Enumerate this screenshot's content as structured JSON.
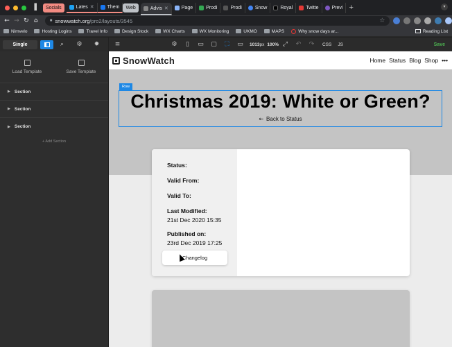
{
  "browser": {
    "tabs": {
      "group_socials": "Socials",
      "group_web": "Web",
      "items": [
        {
          "label": "Lates",
          "color": "#1da1f2"
        },
        {
          "label": "Them",
          "color": "#1877f2"
        },
        {
          "label": "Advis",
          "color": "#888888"
        },
        {
          "label": "Page",
          "color": "#8ab4f8"
        },
        {
          "label": "Prodi",
          "color": "#34a853"
        },
        {
          "label": "Prodi",
          "color": "#222222"
        },
        {
          "label": "Snow",
          "color": "#4285f4"
        },
        {
          "label": "Royal",
          "color": "#000000"
        },
        {
          "label": "Twitte",
          "color": "#e53935"
        },
        {
          "label": "Previ",
          "color": "#7e57c2"
        }
      ]
    },
    "address": {
      "host": "snowwatch.org",
      "path": "/pro2/layouts/3545"
    },
    "bookmarks": [
      "Nimvelo",
      "Hosting Logins",
      "Travel Info",
      "Design Stock",
      "WX Charts",
      "WX Monitoring",
      "UKMO",
      "MAPS"
    ],
    "bookmark_why": "Why snow days ar...",
    "reading_list": "Reading List"
  },
  "builder": {
    "mode_single": "Single",
    "width_value": "1013",
    "width_unit": "px",
    "zoom": "100%",
    "css_label": "CSS",
    "js_label": "JS",
    "save_label": "Save",
    "load_template": "Load Template",
    "save_template": "Save Template",
    "sections": [
      "Section",
      "Section",
      "Section"
    ],
    "add_section": "+ Add Section"
  },
  "site": {
    "logo_text": "SnowWatch",
    "nav": [
      "Home",
      "Status",
      "Blog",
      "Shop"
    ],
    "nav_more": "•••",
    "row_tag": "Row",
    "hero_title": "Christmas 2019: White or Green?",
    "back_link": "Back to Status",
    "meta": {
      "status_label": "Status:",
      "valid_from_label": "Valid From:",
      "valid_to_label": "Valid To:",
      "last_modified_label": "Last Modified:",
      "last_modified_value": "21st Dec 2020 15:35",
      "published_label": "Published on:",
      "published_value": "23rd Dec 2019 17:25"
    },
    "changelog_label": "Changelog"
  }
}
